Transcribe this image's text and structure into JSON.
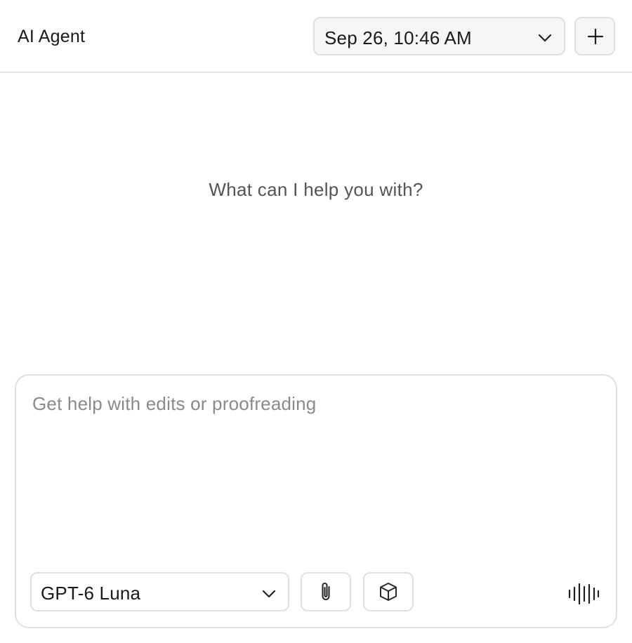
{
  "header": {
    "title": "AI Agent",
    "session_selector": {
      "value": "Sep 26, 10:46 AM",
      "icon": "chevron-down-icon"
    },
    "new_chat_button": {
      "icon": "plus-icon"
    }
  },
  "main": {
    "empty_prompt": "What can I help you with?"
  },
  "composer": {
    "placeholder": "Get help with edits or proofreading",
    "value": "",
    "model_selector": {
      "value": "GPT-6 Luna",
      "icon": "chevron-down-icon"
    },
    "attach_button": {
      "icon": "paperclip-icon"
    },
    "context_button": {
      "icon": "cube-icon"
    },
    "voice_button": {
      "icon": "audio-waveform-icon"
    }
  },
  "colors": {
    "border": "#e3dfe0",
    "select_background": "#f6f6f6",
    "placeholder": "#8a8a8a",
    "muted_text": "#545454"
  }
}
